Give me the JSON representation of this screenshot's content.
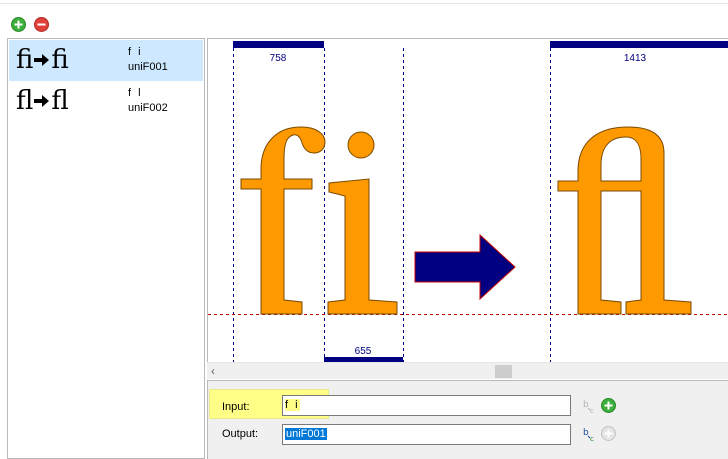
{
  "toolbar": {
    "add_icon": "add-circle-icon",
    "remove_icon": "remove-circle-icon",
    "colors": {
      "add": "#3cae3c",
      "remove": "#e0403a"
    }
  },
  "ligatures": [
    {
      "components": "fi",
      "ligature": "ﬁ",
      "input": "f i",
      "output": "uniF001",
      "selected": true
    },
    {
      "components": "fl",
      "ligature": "ﬂ",
      "input": "f l",
      "output": "uniF002",
      "selected": false
    }
  ],
  "preview": {
    "component_advances": [
      "758",
      "655"
    ],
    "ligature_advance": "1413",
    "glyph_fill": "#ff9900",
    "arrow_fill": "#000080",
    "metric_color": "#000080",
    "baseline_color": "#c00000"
  },
  "form": {
    "input_label": "Input:",
    "input_value": "f i",
    "output_label": "Output:",
    "output_value": "uniF001"
  }
}
